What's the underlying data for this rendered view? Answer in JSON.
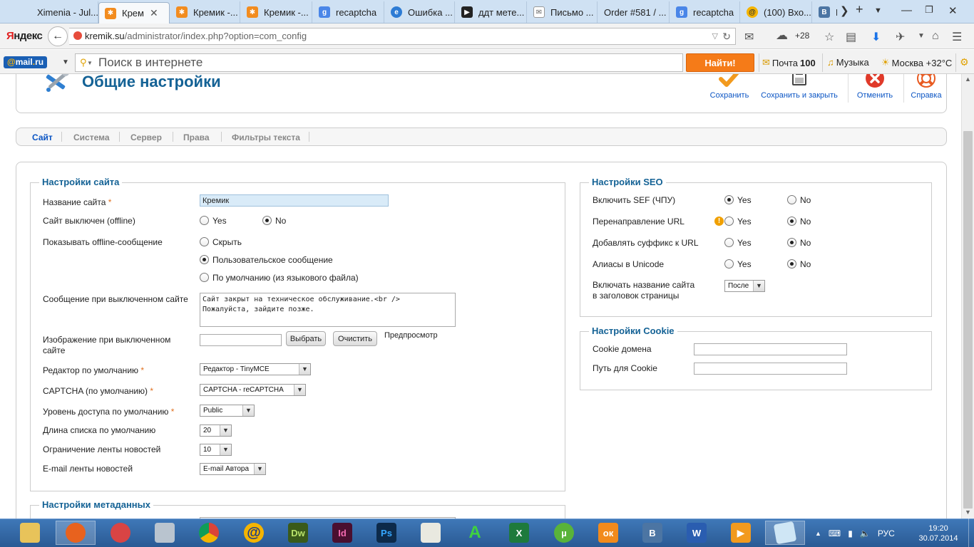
{
  "browser": {
    "tabs": [
      {
        "title": "Ximenia - Jul...",
        "icon": "joomla-icon"
      },
      {
        "title": "Крем",
        "icon": "joomla-icon",
        "active": true
      },
      {
        "title": "Кремик -...",
        "icon": "joomla-icon"
      },
      {
        "title": "Кремик -...",
        "icon": "joomla-icon"
      },
      {
        "title": "recaptcha",
        "icon": "google-icon"
      },
      {
        "title": "Ошибка ...",
        "icon": "edge-icon"
      },
      {
        "title": "ддт мете...",
        "icon": "video-icon"
      },
      {
        "title": "Письмо ...",
        "icon": "mail-icon"
      },
      {
        "title": "Order #581 / ...",
        "icon": "none"
      },
      {
        "title": "recaptcha",
        "icon": "google-icon"
      },
      {
        "title": "(100) Вхо...",
        "icon": "mailru-at-icon"
      },
      {
        "title": "Г",
        "icon": "vk-icon"
      }
    ],
    "address": {
      "host": "kremik.su",
      "path": "/administrator/index.php?option=com_config"
    },
    "yandex_logo": {
      "first": "Я",
      "rest": "ндекс"
    },
    "weather_temp": "+28"
  },
  "mailru_bar": {
    "logo": {
      "at": "@",
      "name": "mail",
      "dot": ".",
      "tld": "ru"
    },
    "search_placeholder": "Поиск в интернете",
    "search_button": "Найти!",
    "mail_label": "Почта",
    "mail_count": "100",
    "music_label": "Музыка",
    "weather_label": "Москва +32°C"
  },
  "page": {
    "title": "Общие настройки",
    "toolbar": {
      "save": "Сохранить",
      "save_close": "Сохранить и закрыть",
      "cancel": "Отменить",
      "help": "Справка"
    },
    "tabs": [
      "Сайт",
      "Система",
      "Сервер",
      "Права",
      "Фильтры текста"
    ],
    "site": {
      "legend": "Настройки сайта",
      "site_name": {
        "label": "Название сайта",
        "value": "Кремик"
      },
      "offline": {
        "label": "Сайт выключен (offline)",
        "yes": "Yes",
        "no": "No",
        "selected": "no"
      },
      "offline_msg": {
        "label": "Показывать offline-сообщение",
        "options": [
          "Скрыть",
          "Пользовательское сообщение",
          "По умолчанию (из языкового файла)"
        ],
        "selected": 1
      },
      "offline_text": {
        "label": "Сообщение при выключенном сайте",
        "value": "Сайт закрыт на техническое обслуживание.<br />\nПожалуйста, зайдите позже."
      },
      "offline_image": {
        "label_line1": "Изображение при выключенном",
        "label_line2": "сайте",
        "select_btn": "Выбрать",
        "clear_btn": "Очистить",
        "preview": "Предпросмотр"
      },
      "editor": {
        "label": "Редактор по умолчанию",
        "value": "Редактор - TinyMCE"
      },
      "captcha": {
        "label": "CAPTCHA (по умолчанию)",
        "value": "CAPTCHA - reCAPTCHA"
      },
      "access": {
        "label": "Уровень доступа по умолчанию",
        "value": "Public"
      },
      "list_limit": {
        "label": "Длина списка по умолчанию",
        "value": "20"
      },
      "feed_limit": {
        "label": "Ограничение ленты новостей",
        "value": "10"
      },
      "feed_email": {
        "label": "E-mail ленты новостей",
        "value": "E-mail Автора"
      }
    },
    "metadata": {
      "legend": "Настройки метаданных"
    },
    "seo": {
      "legend": "Настройки SEO",
      "sef": {
        "label": "Включить SEF (ЧПУ)",
        "yes": "Yes",
        "no": "No",
        "selected": "yes"
      },
      "rewrite": {
        "label": "Перенаправление URL",
        "yes": "Yes",
        "no": "No",
        "selected": "no",
        "warning": "!"
      },
      "suffix": {
        "label": "Добавлять суффикс к URL",
        "yes": "Yes",
        "no": "No",
        "selected": "no"
      },
      "unicode": {
        "label": "Алиасы в Unicode",
        "yes": "Yes",
        "no": "No",
        "selected": "no"
      },
      "sitename_pagetitles": {
        "label_line1": "Включать название сайта",
        "label_line2": "в заголовок страницы",
        "value": "После"
      }
    },
    "cookie": {
      "legend": "Настройки Cookie",
      "domain": {
        "label": "Cookie домена",
        "value": ""
      },
      "path": {
        "label": "Путь для Cookie",
        "value": ""
      }
    }
  },
  "taskbar": {
    "apps": [
      {
        "name": "explorer",
        "label": ""
      },
      {
        "name": "firefox",
        "label": ""
      },
      {
        "name": "paint",
        "label": ""
      },
      {
        "name": "calculator",
        "label": ""
      },
      {
        "name": "chrome",
        "label": ""
      },
      {
        "name": "mailru-agent",
        "label": "@"
      },
      {
        "name": "dreamweaver",
        "label": "Dw"
      },
      {
        "name": "indesign",
        "label": "Id"
      },
      {
        "name": "photoshop",
        "label": "Ps"
      },
      {
        "name": "notepad-plus",
        "label": ""
      },
      {
        "name": "font-app",
        "label": "A"
      },
      {
        "name": "excel",
        "label": "X"
      },
      {
        "name": "utorrent",
        "label": "µ"
      },
      {
        "name": "odnoklassniki",
        "label": "ок"
      },
      {
        "name": "vkontakte",
        "label": "В"
      },
      {
        "name": "word",
        "label": "W"
      },
      {
        "name": "media-player",
        "label": "▶"
      },
      {
        "name": "notes",
        "label": ""
      }
    ],
    "language": "РУС",
    "time": "19:20",
    "date": "30.07.2014"
  }
}
